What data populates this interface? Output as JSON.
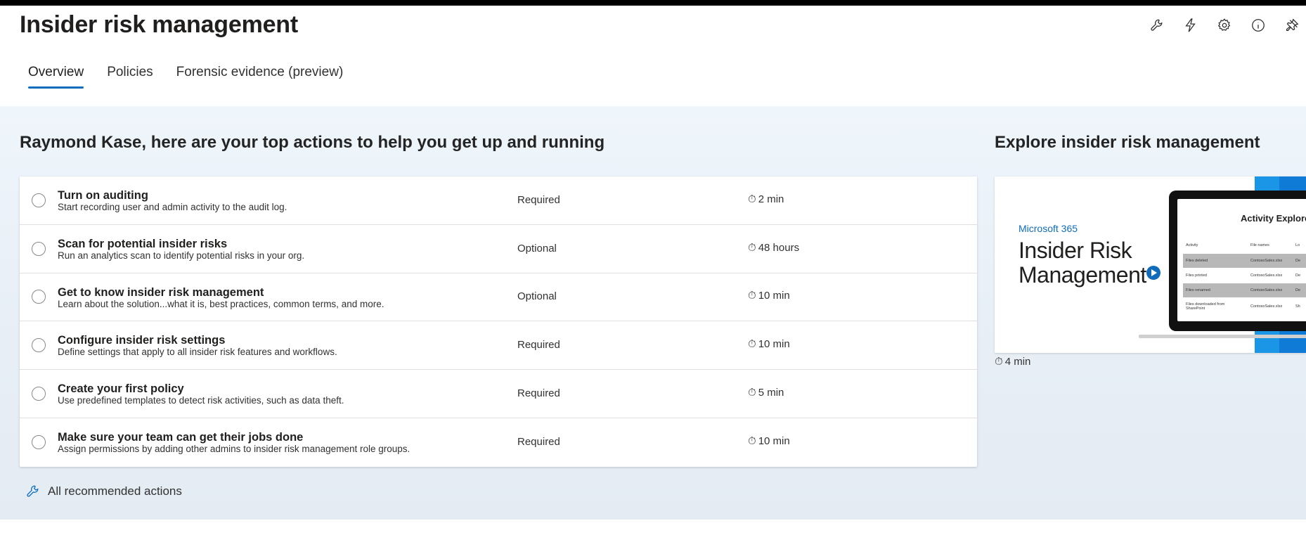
{
  "header": {
    "title": "Insider risk management",
    "tool_icons": [
      "wrench-icon",
      "lightning-icon",
      "gear-icon",
      "info-icon",
      "pin-off-icon"
    ]
  },
  "tabs": [
    {
      "label": "Overview",
      "active": true
    },
    {
      "label": "Policies",
      "active": false
    },
    {
      "label": "Forensic evidence (preview)",
      "active": false
    }
  ],
  "actions": {
    "heading": "Raymond Kase, here are your top actions to help you get up and running",
    "items": [
      {
        "title": "Turn on auditing",
        "description": "Start recording user and admin activity to the audit log.",
        "status": "Required",
        "time": "2 min"
      },
      {
        "title": "Scan for potential insider risks",
        "description": "Run an analytics scan to identify potential risks in your org.",
        "status": "Optional",
        "time": "48 hours"
      },
      {
        "title": "Get to know insider risk management",
        "description": "Learn about the solution...what it is, best practices, common terms, and more.",
        "status": "Optional",
        "time": "10 min"
      },
      {
        "title": "Configure insider risk settings",
        "description": "Define settings that apply to all insider risk features and workflows.",
        "status": "Required",
        "time": "10 min"
      },
      {
        "title": "Create your first policy",
        "description": "Use predefined templates to detect risk activities, such as data theft.",
        "status": "Required",
        "time": "5 min"
      },
      {
        "title": "Make sure your team can get their jobs done",
        "description": "Assign permissions by adding other admins to insider risk management role groups.",
        "status": "Required",
        "time": "10 min"
      }
    ],
    "all_label": "All recommended actions"
  },
  "explore": {
    "heading": "Explore insider risk management",
    "video": {
      "brand": "Microsoft 365",
      "title_line1": "Insider Risk",
      "title_line2": "Management",
      "screen_title": "Activity Explorer",
      "screen_header": [
        "Activity",
        "File names",
        "Lo"
      ],
      "screen_rows": [
        [
          "Files deleted",
          "ContosoSales.xlsx",
          "De"
        ],
        [
          "Files printed",
          "ContosoSales.xlsx",
          "De"
        ],
        [
          "Files renamed",
          "ContosoSales.xlsx",
          "De"
        ],
        [
          "Files downloaded from SharePoint",
          "ContosoSales.xlsx",
          "Sh"
        ]
      ],
      "duration": "4 min"
    }
  },
  "colors": {
    "accent": "#0f6cbd",
    "band": "#e7eef6"
  }
}
